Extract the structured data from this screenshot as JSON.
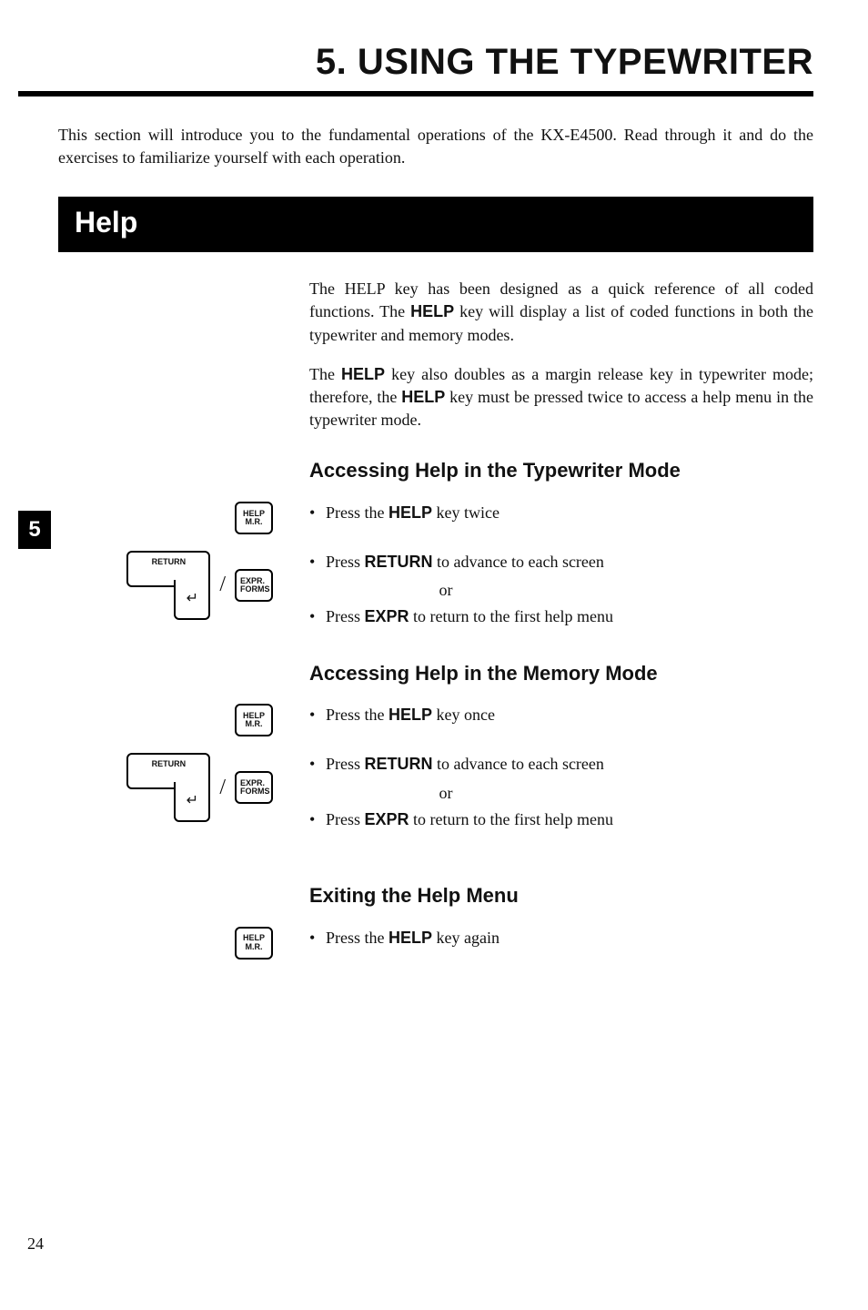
{
  "chapter": {
    "title": "5.  USING THE TYPEWRITER"
  },
  "intro": "This section will introduce you to the fundamental operations of the KX-E4500. Read through it and do the exercises to familiarize yourself with each operation.",
  "section": {
    "title": "Help"
  },
  "tab": "5",
  "help": {
    "p1a": "The HELP key has been designed as a quick reference of all coded functions. The ",
    "p1b": "HELP",
    "p1c": " key will display a list of coded functions in both the typewriter and memory modes.",
    "p2a": "The ",
    "p2b": "HELP",
    "p2c": " key also doubles as a margin release key in typewriter mode; therefore, the ",
    "p2d": "HELP",
    "p2e": " key must be pressed twice to access a help menu in the typewriter mode.",
    "typewriter": {
      "heading": "Accessing Help in the Typewriter Mode",
      "b1a": "Press the ",
      "b1b": "HELP",
      "b1c": " key twice",
      "b2a": "Press ",
      "b2b": "RETURN",
      "b2c": " to advance to each screen",
      "or": "or",
      "b3a": "Press ",
      "b3b": "EXPR",
      "b3c": " to return to the first help menu"
    },
    "memory": {
      "heading": "Accessing Help in the Memory Mode",
      "b1a": "Press the ",
      "b1b": "HELP",
      "b1c": " key once",
      "b2a": "Press ",
      "b2b": "RETURN",
      "b2c": " to advance to each screen",
      "or": "or",
      "b3a": "Press ",
      "b3b": "EXPR",
      "b3c": " to return to the first help menu"
    },
    "exit": {
      "heading": "Exiting the Help Menu",
      "b1a": "Press the ",
      "b1b": "HELP",
      "b1c": " key again"
    }
  },
  "keys": {
    "help_l1": "HELP",
    "help_l2": "M.R.",
    "return": "RETURN",
    "return_arrow": "↵",
    "expr_l1": "EXPR.",
    "expr_l2": "FORMS",
    "slash": "/"
  },
  "page_number": "24"
}
